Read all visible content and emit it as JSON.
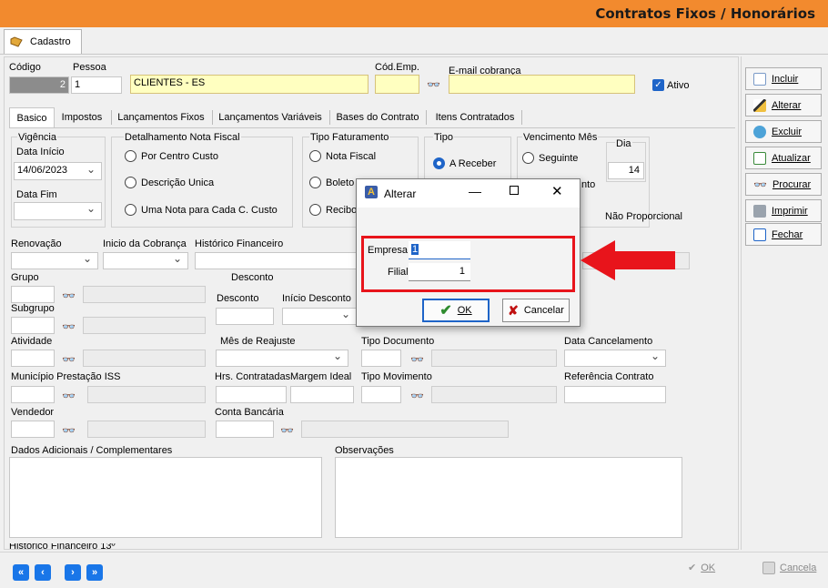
{
  "app": {
    "title": "Contratos Fixos / Honorários",
    "main_tab": "Cadastro"
  },
  "header": {
    "codigo_label": "Código",
    "codigo_value": "2",
    "pessoa_label": "Pessoa",
    "pessoa_value": "1",
    "pessoa_name": "CLIENTES - ES",
    "cod_emp_label": "Cód.Emp.",
    "email_label": "E-mail cobrança",
    "ativo_label": "Ativo"
  },
  "subtabs": [
    "Basico",
    "Impostos",
    "Lançamentos Fixos",
    "Lançamentos Variáveis",
    "Bases do Contrato",
    "Itens Contratados"
  ],
  "vigencia": {
    "title": "Vigência",
    "inicio_label": "Data Início",
    "inicio_value": "14/06/2023",
    "fim_label": "Data Fim"
  },
  "nota_fiscal": {
    "title": "Detalhamento Nota Fiscal",
    "options": [
      "Por Centro Custo",
      "Descrição Unica",
      "Uma Nota para Cada C. Custo"
    ]
  },
  "faturamento": {
    "title": "Tipo Faturamento",
    "options": [
      "Nota Fiscal",
      "Boleto",
      "Recibo"
    ]
  },
  "tipo": {
    "title": "Tipo",
    "option": "A Receber"
  },
  "vencimento": {
    "title": "Vencimento Mês",
    "dia_label": "Dia",
    "dia_value": "14",
    "seguinte": "Seguinte",
    "partial": "nto",
    "nao_proporcional": "Não Proporcional"
  },
  "fields": {
    "renovacao": "Renovação",
    "inicio_cobranca": "Inicio da Cobrança",
    "historico_fin": "Histórico Financeiro",
    "grupo": "Grupo",
    "desconto_header": "Desconto",
    "desconto": "Desconto",
    "inicio_desconto": "Início Desconto",
    "subgrupo": "Subgrupo",
    "atividade": "Atividade",
    "mes_reajuste": "Mês de Reajuste",
    "tipo_documento": "Tipo Documento",
    "data_cancelamento": "Data Cancelamento",
    "municipio": "Município Prestação ISS",
    "hrs": "Hrs. Contratadas",
    "margem": "Margem Ideal",
    "tipo_movimento": "Tipo Movimento",
    "referencia": "Referência Contrato",
    "vendedor": "Vendedor",
    "conta_bancaria": "Conta Bancária",
    "dados_adicionais": "Dados Adicionais / Complementares",
    "observacoes": "Observações",
    "historico_13": "Histórico Financeiro 13º"
  },
  "side_buttons": [
    "Incluir",
    "Alterar",
    "Excluir",
    "Atualizar",
    "Procurar",
    "Imprimir",
    "Fechar"
  ],
  "bottom": {
    "ok": "OK",
    "cancel": "Cancela"
  },
  "dialog": {
    "title": "Alterar",
    "empresa_label": "Empresa",
    "empresa_value": "1",
    "filial_label": "Filial",
    "filial_value": "1",
    "ok": "OK",
    "cancel": "Cancelar"
  },
  "colors": {
    "titlebar": "#f28a2e",
    "highlight": "#e8141b",
    "accent": "#1976e8"
  }
}
